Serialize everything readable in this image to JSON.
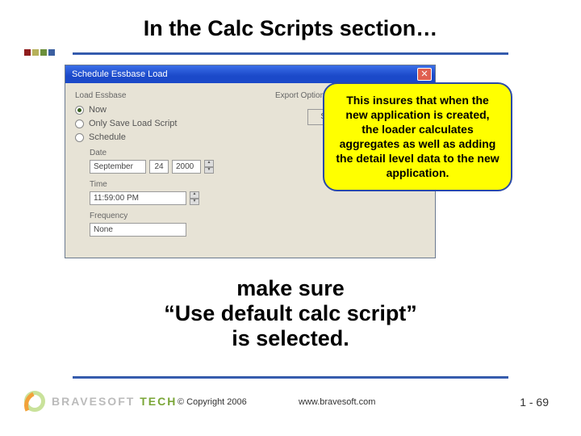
{
  "slide": {
    "title": "In the Calc Scripts section…",
    "instruction_l1": "make sure",
    "instruction_l2": "“Use default calc script”",
    "instruction_l3": "is selected."
  },
  "dialog": {
    "title": "Schedule Essbase Load",
    "group_label": "Load Essbase",
    "radio_now": "Now",
    "radio_only_save": "Only Save Load Script",
    "radio_schedule": "Schedule",
    "date_label": "Date",
    "date_month": "September",
    "date_day": "24",
    "date_year": "2000",
    "time_label": "Time",
    "time_value": "11:59:00 PM",
    "freq_label": "Frequency",
    "freq_value": "None",
    "export_label": "Export Options",
    "save_button": "Save Sc"
  },
  "callout": {
    "text": "This insures that when the new application is created, the loader calculates aggregates as well as adding the detail level data to the new application."
  },
  "footer": {
    "brand_a": "BRAVESOFT",
    "brand_b": "TECH",
    "copyright": "© Copyright 2006",
    "website": "www.bravesoft.com",
    "page": "1 - 69"
  },
  "colors": {
    "block1": "#8f1d1d",
    "block2": "#b6b15a",
    "block3": "#6b8f3b",
    "block4": "#3b5fa0"
  }
}
